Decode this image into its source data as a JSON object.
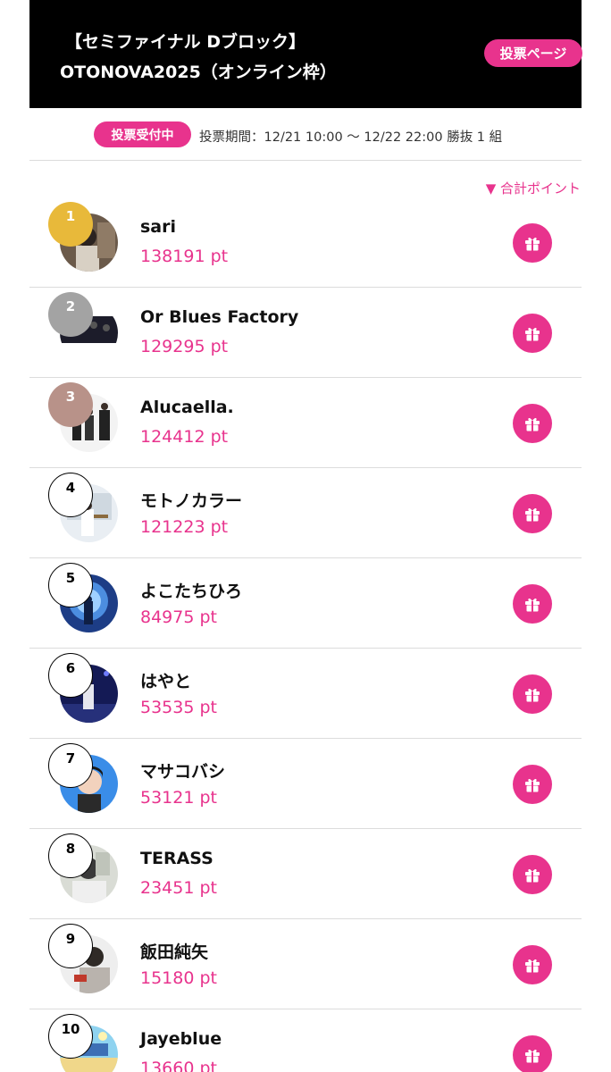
{
  "header": {
    "title_line1": "【セミファイナル Dブロック】",
    "title_line2": "OTONOVA2025（オンライン枠）",
    "vote_page_label": "投票ページ"
  },
  "status": {
    "badge": "投票受付中",
    "period_text": "投票期間：12/21 10:00 〜 12/22 22:00  勝抜 1 組"
  },
  "sort_label": "▼ 合計ポイント",
  "colors": {
    "accent": "#e8338d",
    "gold": "#e8b93a",
    "silver": "#a3a3a3",
    "bronze": "#b89289"
  },
  "entries": [
    {
      "rank": "1",
      "name": "sari",
      "points": "138191 pt"
    },
    {
      "rank": "2",
      "name": "Or Blues Factory",
      "points": "129295 pt"
    },
    {
      "rank": "3",
      "name": "Alucaella.",
      "points": "124412 pt"
    },
    {
      "rank": "4",
      "name": "モトノカラー",
      "points": "121223 pt"
    },
    {
      "rank": "5",
      "name": "よこたちひろ",
      "points": "84975 pt"
    },
    {
      "rank": "6",
      "name": "はやと",
      "points": "53535 pt"
    },
    {
      "rank": "7",
      "name": "マサコバシ",
      "points": "53121 pt"
    },
    {
      "rank": "8",
      "name": "TERASS",
      "points": "23451 pt"
    },
    {
      "rank": "9",
      "name": "飯田純矢",
      "points": "15180 pt"
    },
    {
      "rank": "10",
      "name": "Jayeblue",
      "points": "13660 pt"
    }
  ]
}
